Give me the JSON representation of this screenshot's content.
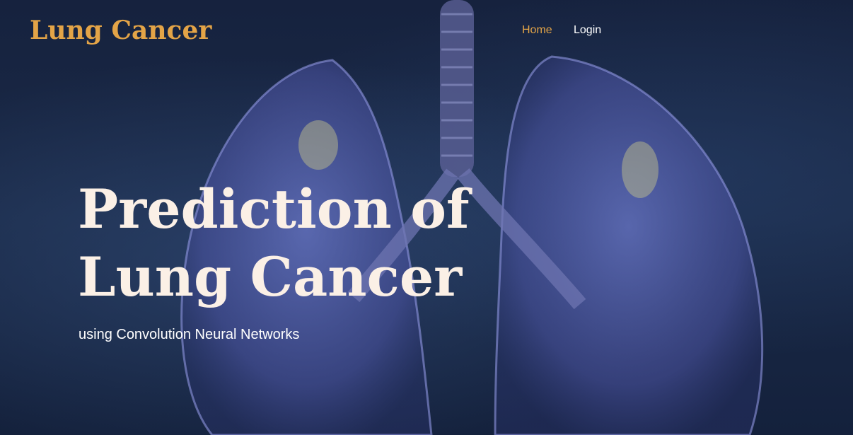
{
  "navbar": {
    "brand": "Lung Cancer",
    "links": [
      {
        "label": "Home",
        "active": true
      },
      {
        "label": "Login",
        "active": false
      }
    ]
  },
  "hero": {
    "title": "Prediction of Lung Cancer",
    "subtitle": "using Convolution Neural Networks",
    "background_image": "lungs-illustration"
  },
  "colors": {
    "brand": "#e3a447",
    "title": "#fbf0e6",
    "background": "#101c36"
  }
}
